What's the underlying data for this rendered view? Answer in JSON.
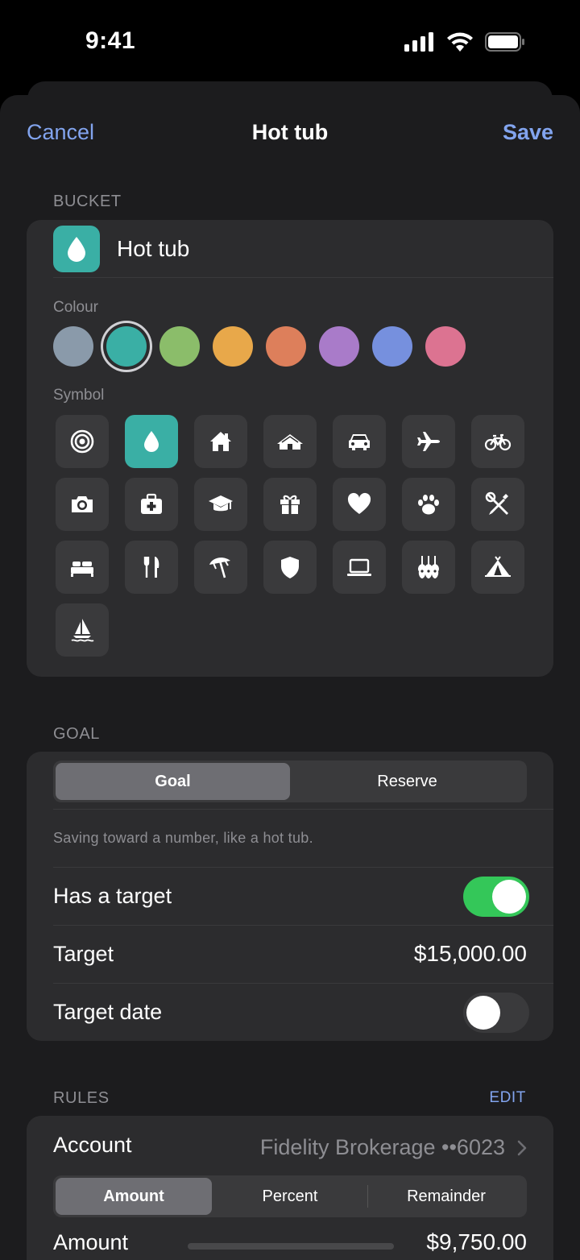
{
  "status": {
    "time": "9:41"
  },
  "nav": {
    "cancel": "Cancel",
    "title": "Hot tub",
    "save": "Save"
  },
  "bucket": {
    "section": "BUCKET",
    "name": "Hot tub",
    "colour_label": "Colour",
    "symbol_label": "Symbol",
    "colours": [
      "#8a9aaa",
      "#3aafa5",
      "#8bbd6a",
      "#e8a84a",
      "#dd7f5b",
      "#a97bc9",
      "#7690de",
      "#dc7391"
    ],
    "selected_colour": "#3aafa5",
    "accent": "#3aafa5",
    "symbols": [
      "target-icon",
      "drop-icon",
      "house-icon",
      "cabin-icon",
      "car-icon",
      "airplane-icon",
      "bicycle-icon",
      "camera-icon",
      "medkit-icon",
      "graduation-cap-icon",
      "gift-icon",
      "heart-icon",
      "paw-icon",
      "tools-icon",
      "bed-icon",
      "fork-knife-icon",
      "beach-umbrella-icon",
      "shield-icon",
      "laptop-icon",
      "guitars-icon",
      "tent-icon",
      "sailboat-icon"
    ],
    "selected_symbol": "drop-icon"
  },
  "goal": {
    "section": "GOAL",
    "segments": [
      "Goal",
      "Reserve"
    ],
    "selected": "Goal",
    "description": "Saving toward a number, like a hot tub.",
    "has_target_label": "Has a target",
    "has_target": true,
    "target_label": "Target",
    "target_value": "$15,000.00",
    "target_date_label": "Target date",
    "target_date": false
  },
  "rules": {
    "section": "RULES",
    "edit": "EDIT",
    "account_label": "Account",
    "account_value": "Fidelity Brokerage ••6023",
    "segments": [
      "Amount",
      "Percent",
      "Remainder"
    ],
    "selected": "Amount",
    "amount_label": "Amount",
    "amount_value": "$9,750.00"
  },
  "colors": {
    "accent_blue": "#82a4ee",
    "toggle_on": "#34c759"
  }
}
